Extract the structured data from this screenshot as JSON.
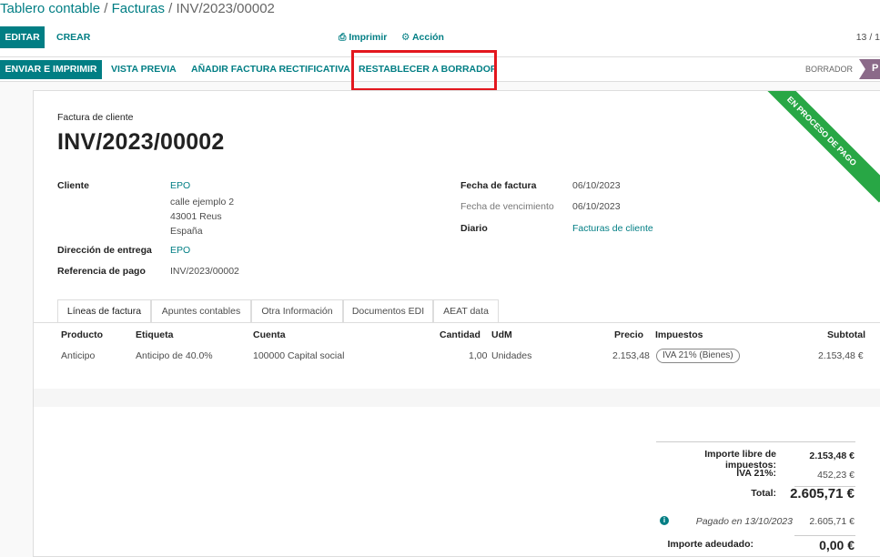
{
  "breadcrumb": {
    "part1": "Tablero contable",
    "sep1": " / ",
    "part2": "Facturas",
    "sep2": " / ",
    "current": "INV/2023/00002"
  },
  "toolbar": {
    "edit": "EDITAR",
    "create": "CREAR",
    "print": "Imprimir",
    "action": "Acción",
    "pager": "13 / 1"
  },
  "status_bar": {
    "send_print": "ENVIAR E IMPRIMIR",
    "preview": "VISTA PREVIA",
    "credit_note": "AÑADIR FACTURA RECTIFICATIVA",
    "reset_draft": "RESTABLECER A BORRADOR",
    "state_draft": "BORRADOR",
    "state_posted": "P"
  },
  "ribbon": "EN PROCESO DE PAGO",
  "invoice": {
    "type": "Factura de cliente",
    "number": "INV/2023/00002",
    "customer_label": "Cliente",
    "customer_name": "EPO",
    "address_line1": "calle ejemplo 2",
    "address_line2": "43001 Reus",
    "address_line3": "España",
    "delivery_label": "Dirección de entrega",
    "delivery_value": "EPO",
    "payment_ref_label": "Referencia de pago",
    "payment_ref_value": "INV/2023/00002",
    "date_label": "Fecha de factura",
    "date_value": "06/10/2023",
    "due_label": "Fecha de vencimiento",
    "due_value": "06/10/2023",
    "journal_label": "Diario",
    "journal_value": "Facturas de cliente"
  },
  "tabs": [
    "Líneas de factura",
    "Apuntes contables",
    "Otra Información",
    "Documentos EDI",
    "AEAT data"
  ],
  "lines": {
    "headers": {
      "product": "Producto",
      "label": "Etiqueta",
      "account": "Cuenta",
      "qty": "Cantidad",
      "uom": "UdM",
      "price": "Precio",
      "taxes": "Impuestos",
      "subtotal": "Subtotal"
    },
    "rows": [
      {
        "product": "Anticipo",
        "label": "Anticipo de 40.0%",
        "account": "100000 Capital social",
        "qty": "1,00",
        "uom": "Unidades",
        "price": "2.153,48",
        "taxes": "IVA 21% (Bienes)",
        "subtotal": "2.153,48 €"
      }
    ]
  },
  "totals": {
    "untaxed_label": "Importe libre de impuestos:",
    "untaxed_value": "2.153,48 €",
    "tax_label": "IVA 21%:",
    "tax_value": "452,23 €",
    "total_label": "Total:",
    "total_value": "2.605,71 €",
    "paid_label": "Pagado en 13/10/2023",
    "paid_value": "2.605,71 €",
    "due_label": "Importe adeudado:",
    "due_value": "0,00 €"
  },
  "colors": {
    "brand": "#017e84",
    "highlight": "#e3171e",
    "ribbon": "#28a745",
    "state_active": "#8b6a89"
  }
}
